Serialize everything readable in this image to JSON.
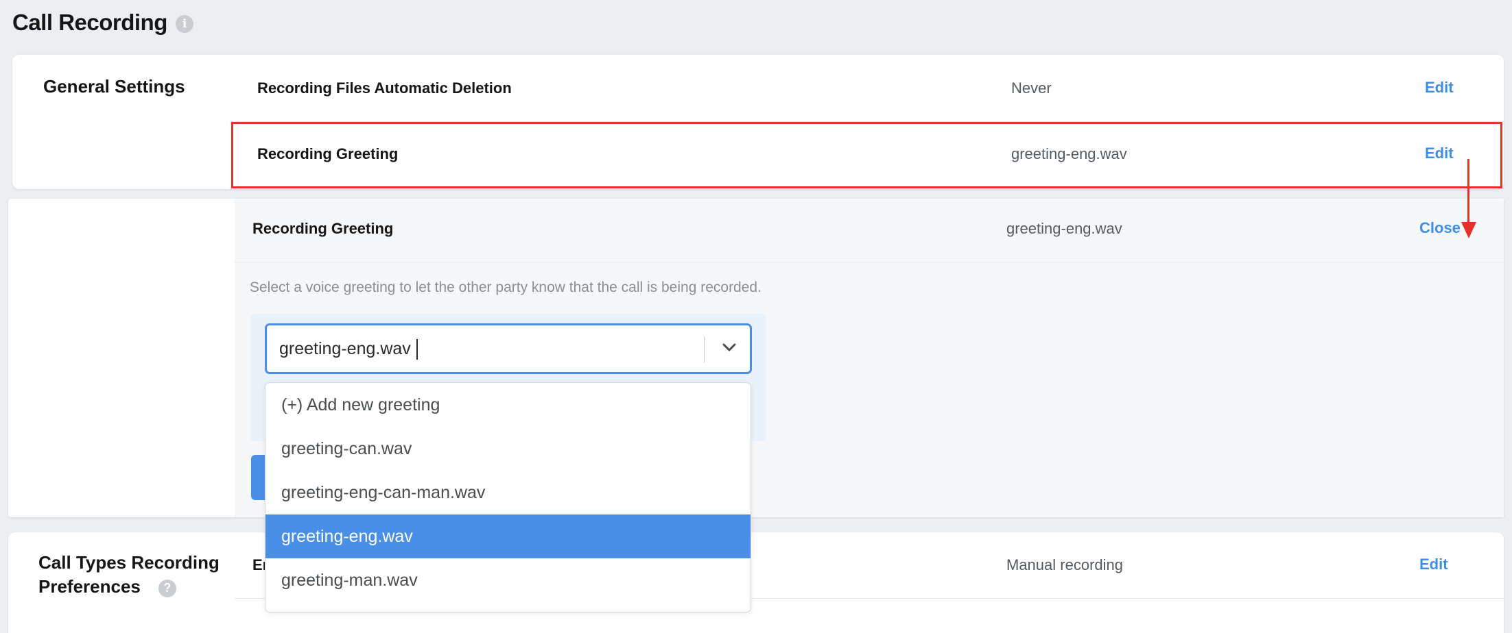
{
  "page": {
    "title": "Call Recording"
  },
  "general_settings": {
    "label": "General Settings",
    "rows": [
      {
        "label": "Recording Files Automatic Deletion",
        "value": "Never",
        "action": "Edit"
      },
      {
        "label": "Recording Greeting",
        "value": "greeting-eng.wav",
        "action": "Edit"
      }
    ]
  },
  "expanded": {
    "label": "Recording Greeting",
    "value": "greeting-eng.wav",
    "action": "Close",
    "hint": "Select a voice greeting to let the other party know that the call is being recorded.",
    "select_value": "greeting-eng.wav",
    "options": [
      "(+) Add new greeting",
      "greeting-can.wav",
      "greeting-eng-can-man.wav",
      "greeting-eng.wav",
      "greeting-man.wav"
    ],
    "selected_option": "greeting-eng.wav"
  },
  "call_types": {
    "label_line1": "Call Types Recording",
    "label_line2": "Preferences",
    "row_label_visible": "Er",
    "row_value": "Manual recording",
    "row_action": "Edit"
  },
  "colors": {
    "accent": "#4a8fe7",
    "link": "#3e8ee6",
    "annotation": "#e4322b"
  },
  "icons": {
    "title_info": "info-icon",
    "dropdown": "chevron-down-icon",
    "help": "question-icon"
  }
}
